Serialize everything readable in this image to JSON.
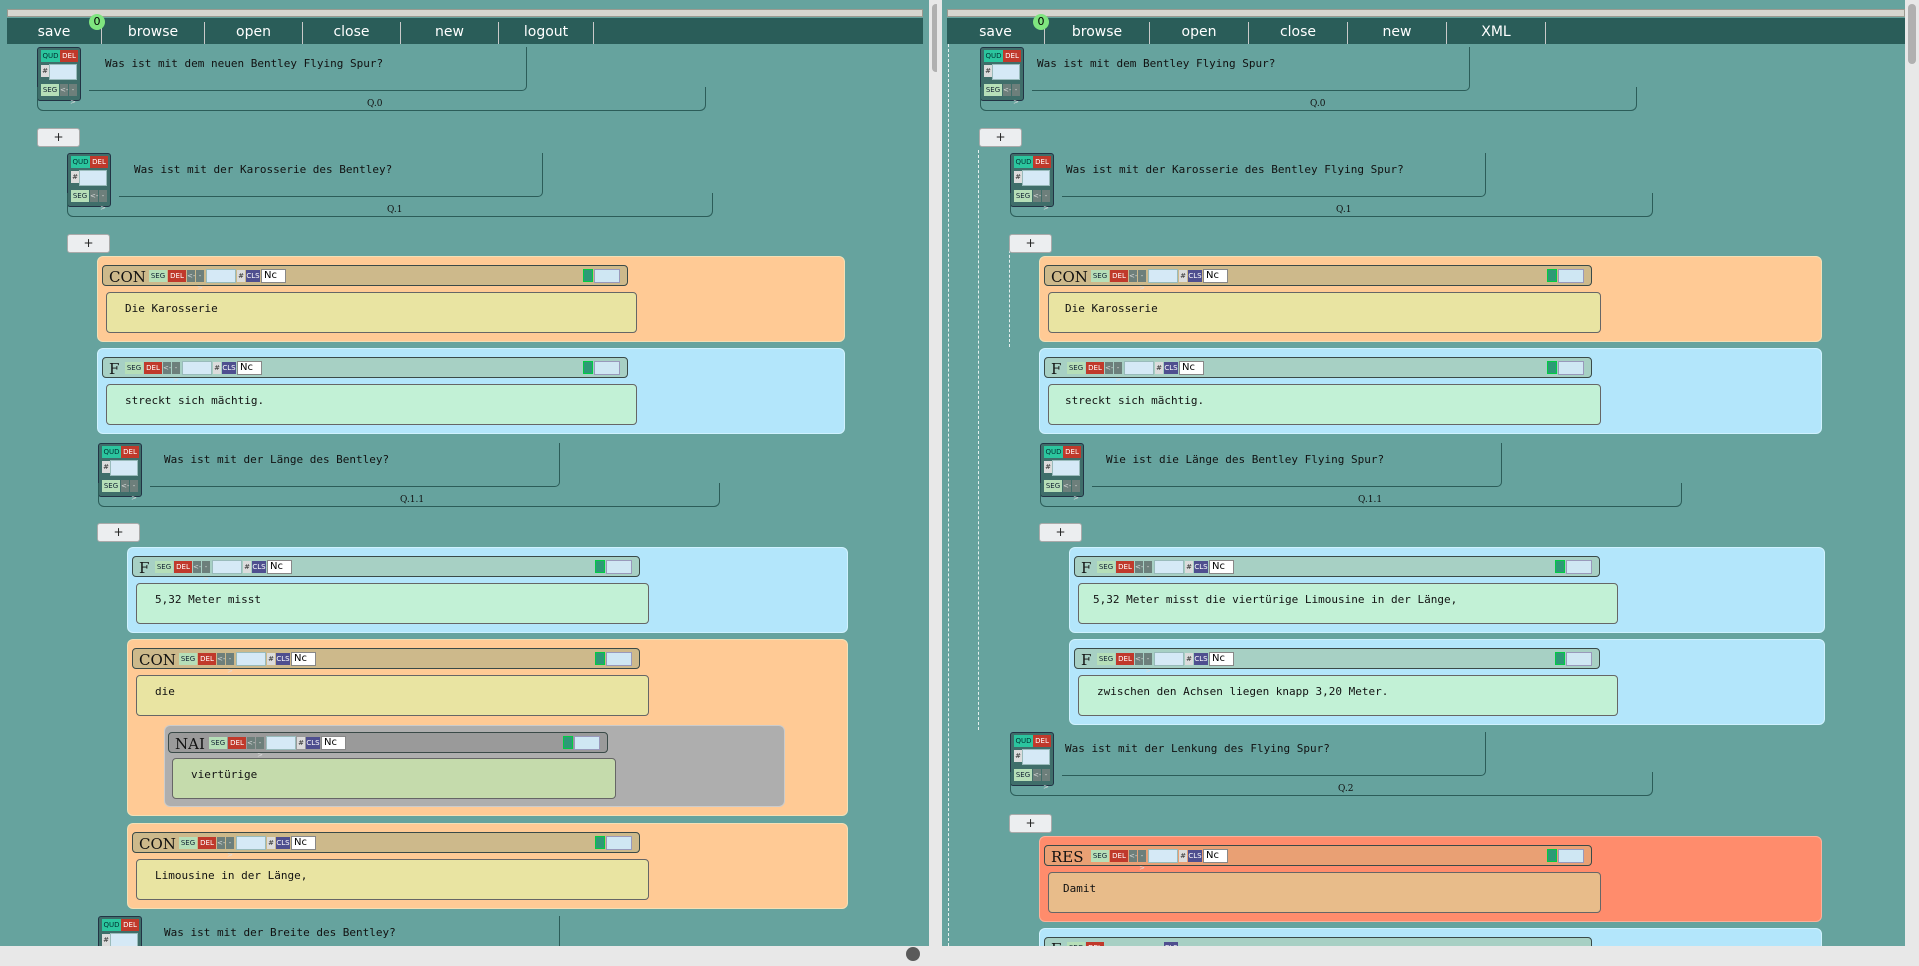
{
  "menus": {
    "left": [
      "save",
      "browse",
      "open",
      "close",
      "new",
      "logout"
    ],
    "right": [
      "save",
      "browse",
      "open",
      "close",
      "new",
      "XML"
    ],
    "badge": "0"
  },
  "buttons": {
    "qud": "QUD",
    "del": "DEL",
    "seg": "SEG",
    "cls": "CLS",
    "hash": "#",
    "plus": "+",
    "nc": "Nc",
    "lt": "<-",
    "gt": "->"
  },
  "left": {
    "q0": {
      "text": "Was ist mit dem neuen Bentley Flying Spur?",
      "label": "Q.0"
    },
    "q1": {
      "text": "Was ist mit der Karosserie des Bentley?",
      "label": "Q.1"
    },
    "con1": {
      "tag": "CON",
      "body": "Die Karosserie"
    },
    "f1": {
      "tag": "F",
      "body": "streckt sich mächtig."
    },
    "q11": {
      "text": "Was ist mit der Länge des Bentley?",
      "label": "Q.1.1"
    },
    "f2": {
      "tag": "F",
      "body": "5,32 Meter misst"
    },
    "con2": {
      "tag": "CON",
      "body": "die"
    },
    "nai": {
      "tag": "NAI",
      "body": "viertürige"
    },
    "con3": {
      "tag": "CON",
      "body": "Limousine in der Länge,"
    },
    "q12": {
      "text": "Was ist mit der Breite des Bentley?"
    }
  },
  "right": {
    "q0": {
      "text": "Was ist mit dem Bentley Flying Spur?",
      "label": "Q.0"
    },
    "q1": {
      "text": "Was ist mit der Karosserie des Bentley Flying Spur?",
      "label": "Q.1"
    },
    "con1": {
      "tag": "CON",
      "body": "Die Karosserie"
    },
    "f1": {
      "tag": "F",
      "body": "streckt sich mächtig."
    },
    "q11": {
      "text": "Wie ist die Länge des Bentley Flying Spur?",
      "label": "Q.1.1"
    },
    "f2": {
      "tag": "F",
      "body": "5,32 Meter misst die viertürige Limousine in der Länge,"
    },
    "f3": {
      "tag": "F",
      "body": "zwischen den Achsen liegen knapp 3,20 Meter."
    },
    "q2": {
      "text": "Was ist mit der Lenkung des Flying Spur?",
      "label": "Q.2"
    },
    "res": {
      "tag": "RES",
      "body": "Damit"
    },
    "f4": {
      "tag": "F"
    }
  }
}
